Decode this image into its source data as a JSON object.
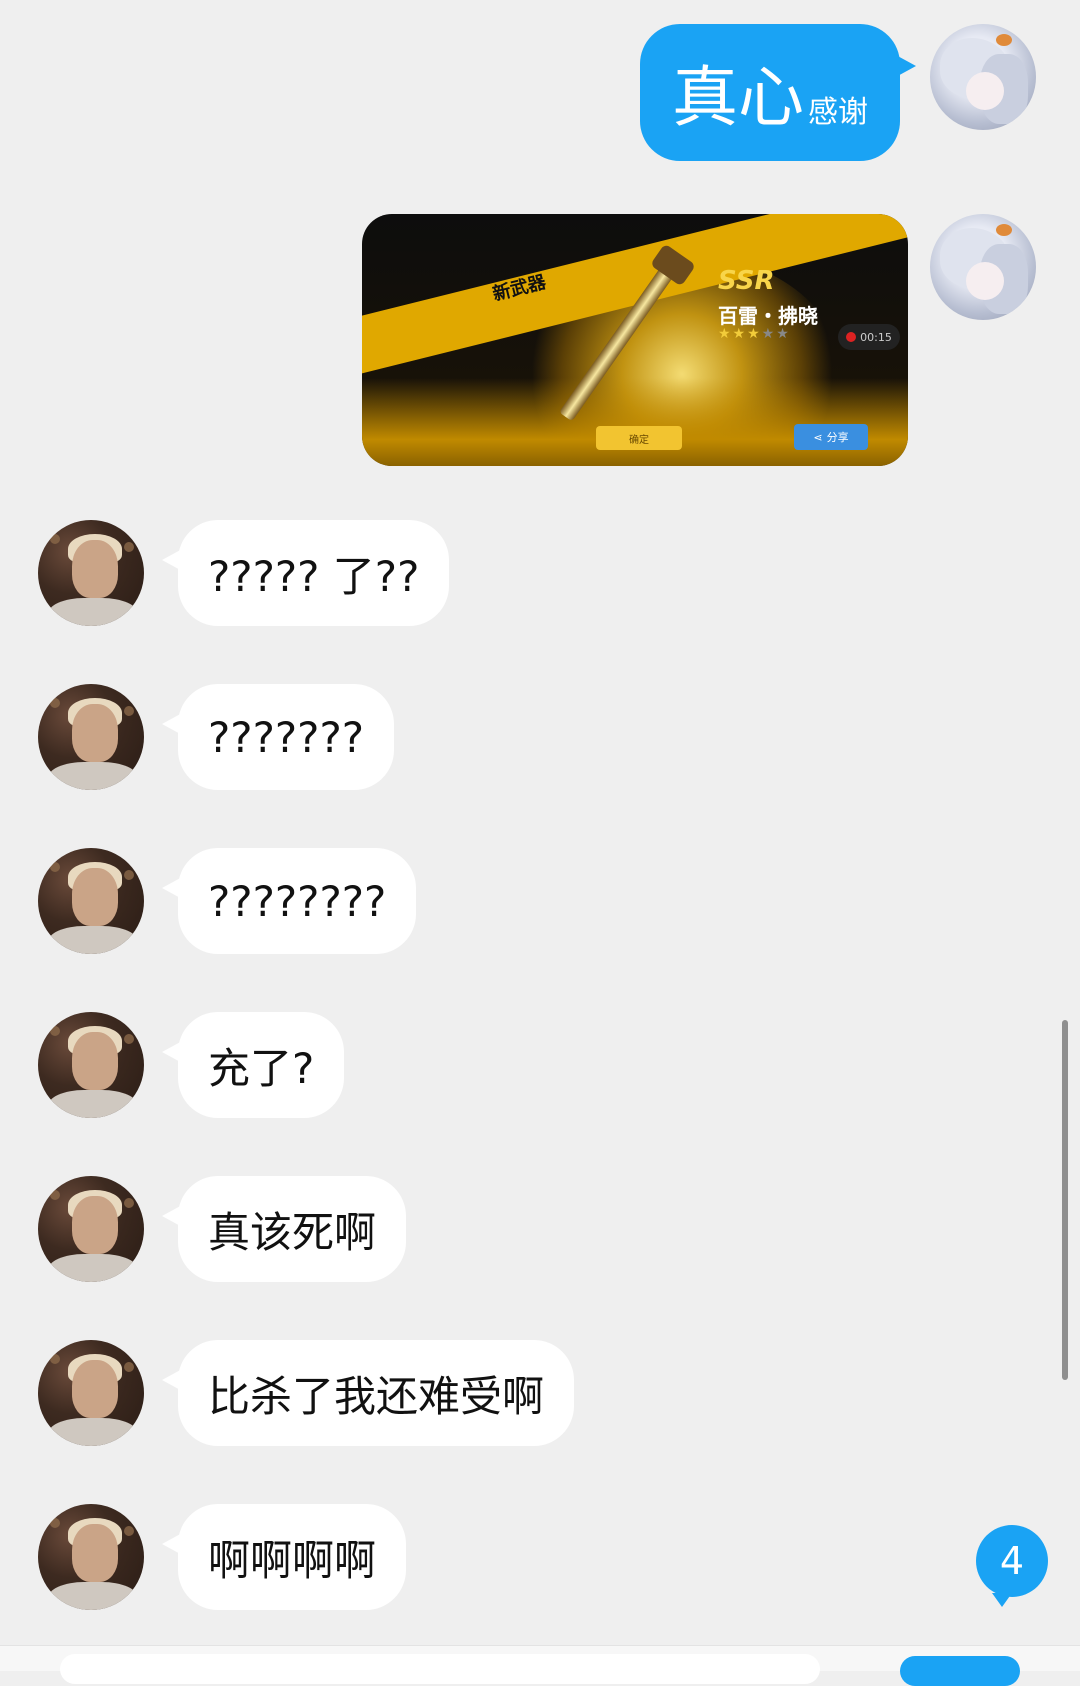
{
  "messages": [
    {
      "side": "out",
      "type": "text",
      "text_big": "真心",
      "text_small": "感谢"
    },
    {
      "side": "out",
      "type": "image",
      "game": {
        "banner": "新武器",
        "rarity": "SSR",
        "weapon": "百雷・拂晓",
        "stars_filled": 3,
        "stars_total": 5,
        "timer": "00:15",
        "confirm": "确定",
        "share": "分享"
      }
    },
    {
      "side": "in",
      "type": "text",
      "text": "????? 了??"
    },
    {
      "side": "in",
      "type": "text",
      "text": "???????"
    },
    {
      "side": "in",
      "type": "text",
      "text": "????????"
    },
    {
      "side": "in",
      "type": "text",
      "text": "充了?"
    },
    {
      "side": "in",
      "type": "text",
      "text": "真该死啊"
    },
    {
      "side": "in",
      "type": "text",
      "text": "比杀了我还难受啊"
    },
    {
      "side": "in",
      "type": "text",
      "text": "啊啊啊啊"
    }
  ],
  "unread_badge": "4",
  "colors": {
    "background": "#efefef",
    "out_bubble": "#1aa3f4",
    "in_bubble": "#ffffff"
  }
}
